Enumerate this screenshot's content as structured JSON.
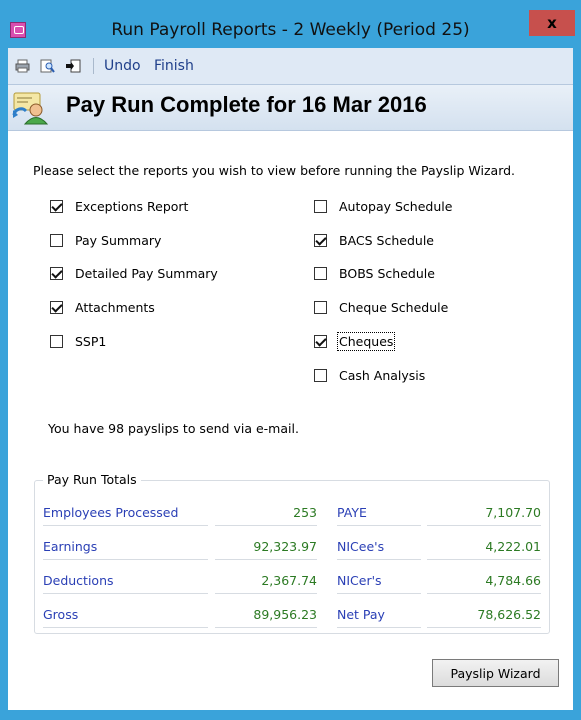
{
  "window": {
    "title": "Run Payroll Reports - 2 Weekly (Period 25)",
    "close_glyph": "x"
  },
  "toolbar": {
    "undo_label": "Undo",
    "finish_label": "Finish"
  },
  "header": {
    "title": "Pay Run Complete for 16 Mar 2016"
  },
  "instructions": "Please select the reports you wish to view before running the Payslip Wizard.",
  "reports_left": [
    {
      "label": "Exceptions Report",
      "checked": true
    },
    {
      "label": "Pay Summary",
      "checked": false
    },
    {
      "label": "Detailed Pay Summary",
      "checked": true
    },
    {
      "label": "Attachments",
      "checked": true
    },
    {
      "label": "SSP1",
      "checked": false
    }
  ],
  "reports_right": [
    {
      "label": "Autopay Schedule",
      "checked": false
    },
    {
      "label": "BACS Schedule",
      "checked": true
    },
    {
      "label": "BOBS Schedule",
      "checked": false
    },
    {
      "label": "Cheque Schedule",
      "checked": false
    },
    {
      "label": "Cheques",
      "checked": true
    },
    {
      "label": "Cash Analysis",
      "checked": false
    }
  ],
  "email_message": "You have 98 payslips to send via e-mail.",
  "totals": {
    "legend": "Pay Run Totals",
    "rows": [
      {
        "label1": "Employees Processed",
        "value1": "253",
        "label2": "PAYE",
        "value2": "7,107.70"
      },
      {
        "label1": "Earnings",
        "value1": "92,323.97",
        "label2": "NICee's",
        "value2": "4,222.01"
      },
      {
        "label1": "Deductions",
        "value1": "2,367.74",
        "label2": "NICer's",
        "value2": "4,784.66"
      },
      {
        "label1": "Gross",
        "value1": "89,956.23",
        "label2": "Net Pay",
        "value2": "78,626.52"
      }
    ]
  },
  "buttons": {
    "payslip_wizard": "Payslip Wizard"
  },
  "colors": {
    "title_bar": "#3aa3da",
    "close_button": "#c7504d",
    "label_blue": "#2a3fb5",
    "value_green": "#2c7a23"
  }
}
